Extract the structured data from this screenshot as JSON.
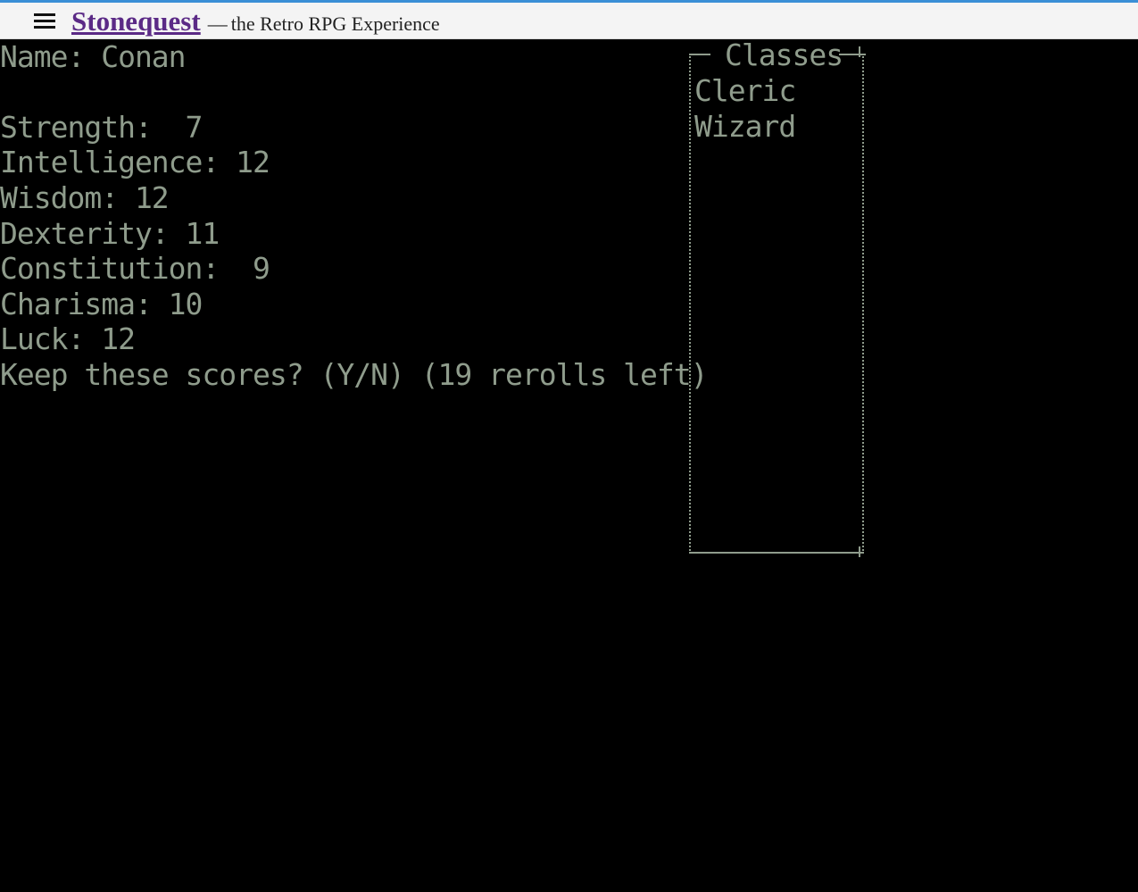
{
  "header": {
    "brand": "Stonequest",
    "separator": "—",
    "tagline": "the Retro RPG Experience"
  },
  "character": {
    "name_line": "Name: Conan",
    "stats": [
      "Strength:  7",
      "Intelligence: 12",
      "Wisdom: 12",
      "Dexterity: 11",
      "Constitution:  9",
      "Charisma: 10",
      "Luck: 12"
    ],
    "prompt": "Keep these scores? (Y/N) (19 rerolls left)"
  },
  "classes_panel": {
    "title": "Classes",
    "items": [
      "Cleric",
      "Wizard"
    ]
  },
  "colors": {
    "terminal_bg": "#000000",
    "terminal_text": "#8f9c8c",
    "brand": "#5b2a86",
    "header_bg": "#f4f4f4",
    "accent_top_border": "#3a8fd6"
  },
  "icons": {
    "menu": "hamburger-menu-icon"
  }
}
